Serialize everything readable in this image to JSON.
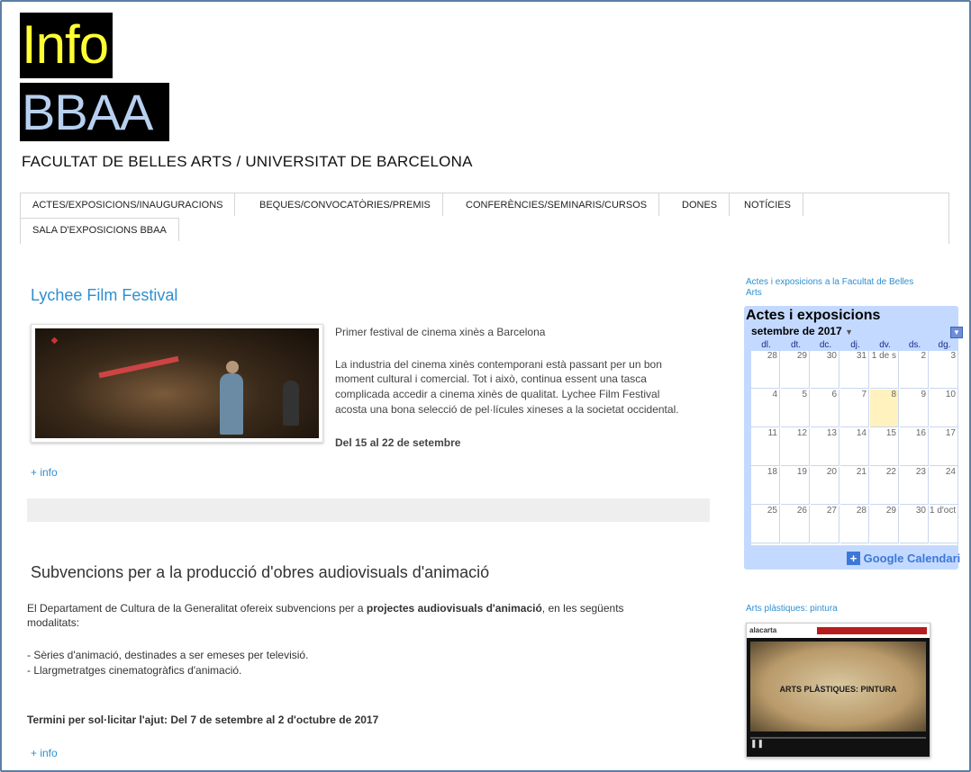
{
  "logo": {
    "line1": "Info",
    "line2": "BBAA"
  },
  "site_subtitle": "FACULTAT DE BELLES ARTS / UNIVERSITAT DE BARCELONA",
  "nav": {
    "row1": [
      "ACTES/EXPOSICIONS/INAUGURACIONS",
      "BEQUES/CONVOCATÒRIES/PREMIS",
      "CONFERÈNCIES/SEMINARIS/CURSOS",
      "DONES",
      "NOTÍCIES"
    ],
    "row2": [
      "SALA D'EXPOSICIONS BBAA"
    ]
  },
  "post1": {
    "title": "Lychee Film Festival",
    "subtitle": "Primer festival de cinema xinès a Barcelona",
    "line1": "La industria del cinema xinès contemporani està passant per un bon",
    "line2": "moment cultural i comercial. Tot i això, continua essent una tasca",
    "line3": "complicada accedir a cinema xinès de qualitat. Lychee Film Festival",
    "line4": "acosta una bona selecció de pel·lícules xineses a la societat occidental.",
    "dates": "Del 15 al 22 de setembre",
    "more": "+ info"
  },
  "post2": {
    "title": "Subvencions per a la producció d'obres audiovisuals d'animació",
    "intro_start": "El Departament de Cultura de la Generalitat ofereix subvencions per a ",
    "intro_bold": "projectes audiovisuals d'animació",
    "intro_end": ", en les següents",
    "intro_line2": "modalitats:",
    "item1": "- Sèries d'animació, destinades a ser emeses per televisió.",
    "item2": "- Llargmetratges cinematogràfics d'animació.",
    "deadline": "Termini per sol·licitar l'ajut: Del 7 de setembre al 2 d'octubre de 2017",
    "more": "+ info"
  },
  "sidebar": {
    "calendar_link": "Actes i exposicions a la Facultat de Belles Arts",
    "calendar_title": "Actes i exposicions",
    "calendar_month": "setembre de 2017",
    "month_dropdown_icon": "triangle-down",
    "weekdays": [
      "dl.",
      "dt.",
      "dc.",
      "dj.",
      "dv.",
      "ds.",
      "dg."
    ],
    "weeks": [
      [
        "28",
        "29",
        "30",
        "31",
        "1 de s",
        "2",
        "3"
      ],
      [
        "4",
        "5",
        "6",
        "7",
        "8",
        "9",
        "10"
      ],
      [
        "11",
        "12",
        "13",
        "14",
        "15",
        "16",
        "17"
      ],
      [
        "18",
        "19",
        "20",
        "21",
        "22",
        "23",
        "24"
      ],
      [
        "25",
        "26",
        "27",
        "28",
        "29",
        "30",
        "1 d'oct"
      ]
    ],
    "today": "8",
    "google_calendar": "Google Calendari",
    "video_link": "Arts plàstiques: pintura",
    "video_site": "alacarta",
    "video_caption": "ARTS PLÀSTIQUES: PINTURA"
  }
}
